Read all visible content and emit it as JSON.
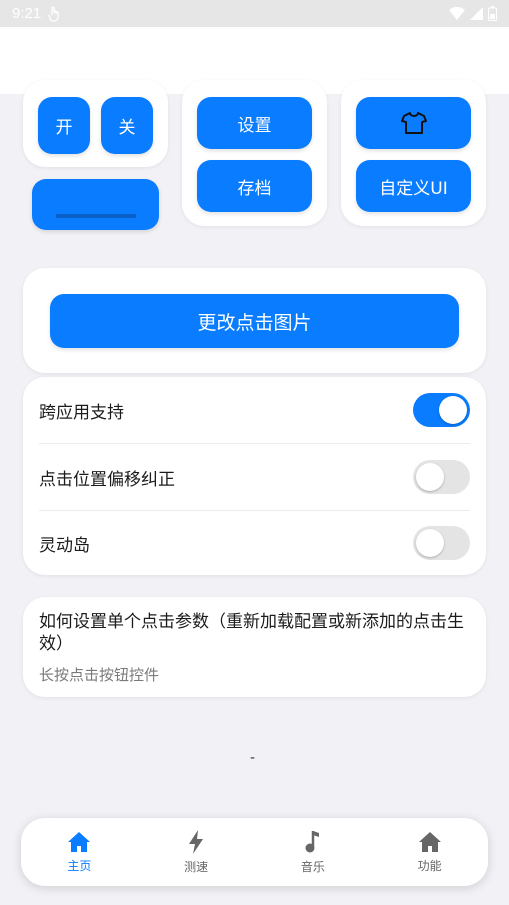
{
  "status": {
    "time": "9:21"
  },
  "quick": {
    "on_label": "开",
    "off_label": "关",
    "settings_label": "设置",
    "archive_label": "存档",
    "custom_ui_label": "自定义UI"
  },
  "change_image": {
    "label": "更改点击图片"
  },
  "toggles": {
    "items": [
      {
        "label": "跨应用支持",
        "on": true
      },
      {
        "label": "点击位置偏移纠正",
        "on": false
      },
      {
        "label": "灵动岛",
        "on": false
      }
    ]
  },
  "info": {
    "title": "如何设置单个点击参数（重新加载配置或新添加的点击生效）",
    "subtitle": "长按点击按钮控件"
  },
  "dash": "-",
  "nav": {
    "items": [
      {
        "label": "主页",
        "icon": "home-icon",
        "active": true
      },
      {
        "label": "测速",
        "icon": "bolt-icon",
        "active": false
      },
      {
        "label": "音乐",
        "icon": "music-note-icon",
        "active": false
      },
      {
        "label": "功能",
        "icon": "home-icon",
        "active": false
      }
    ]
  },
  "colors": {
    "accent": "#0a7cff",
    "background": "#f2f2f6"
  }
}
